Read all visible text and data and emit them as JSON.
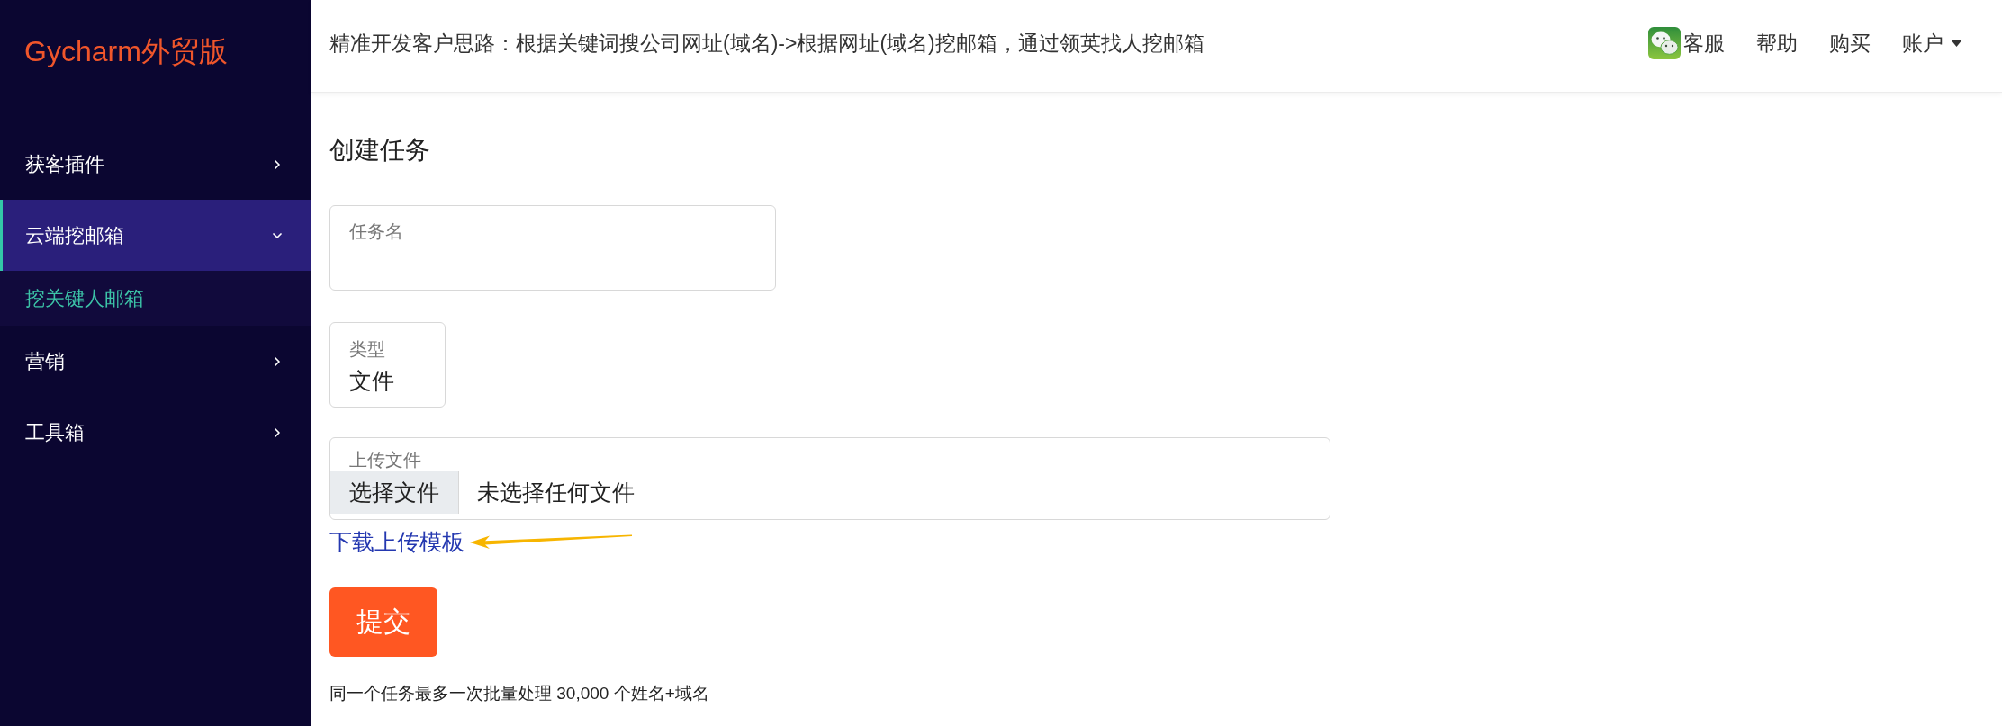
{
  "sidebar": {
    "logo": "Gycharm外贸版",
    "items": [
      {
        "label": "获客插件",
        "expanded": false
      },
      {
        "label": "云端挖邮箱",
        "expanded": true,
        "children": [
          {
            "label": "挖关键人邮箱",
            "selected": true
          }
        ]
      },
      {
        "label": "营销",
        "expanded": false
      },
      {
        "label": "工具箱",
        "expanded": false
      }
    ]
  },
  "header": {
    "notice": "精准开发客户思路：根据关键词搜公司网址(域名)->根据网址(域名)挖邮箱，通过领英找人挖邮箱",
    "links": [
      {
        "label": "客服",
        "kind": "chat"
      },
      {
        "label": "帮助",
        "kind": "plain"
      },
      {
        "label": "购买",
        "kind": "plain"
      },
      {
        "label": "账户",
        "kind": "menu"
      }
    ]
  },
  "form": {
    "title": "创建任务",
    "fields": [
      {
        "kind": "text",
        "label": "任务名"
      },
      {
        "kind": "select",
        "label": "类型",
        "value": "文件"
      },
      {
        "kind": "file",
        "label": "上传文件",
        "button": "选择文件",
        "status": "未选择任何文件"
      }
    ],
    "template_link": "下载上传模板",
    "submit": "提交",
    "note": "同一个任务最多一次批量处理 30,000 个姓名+域名"
  }
}
